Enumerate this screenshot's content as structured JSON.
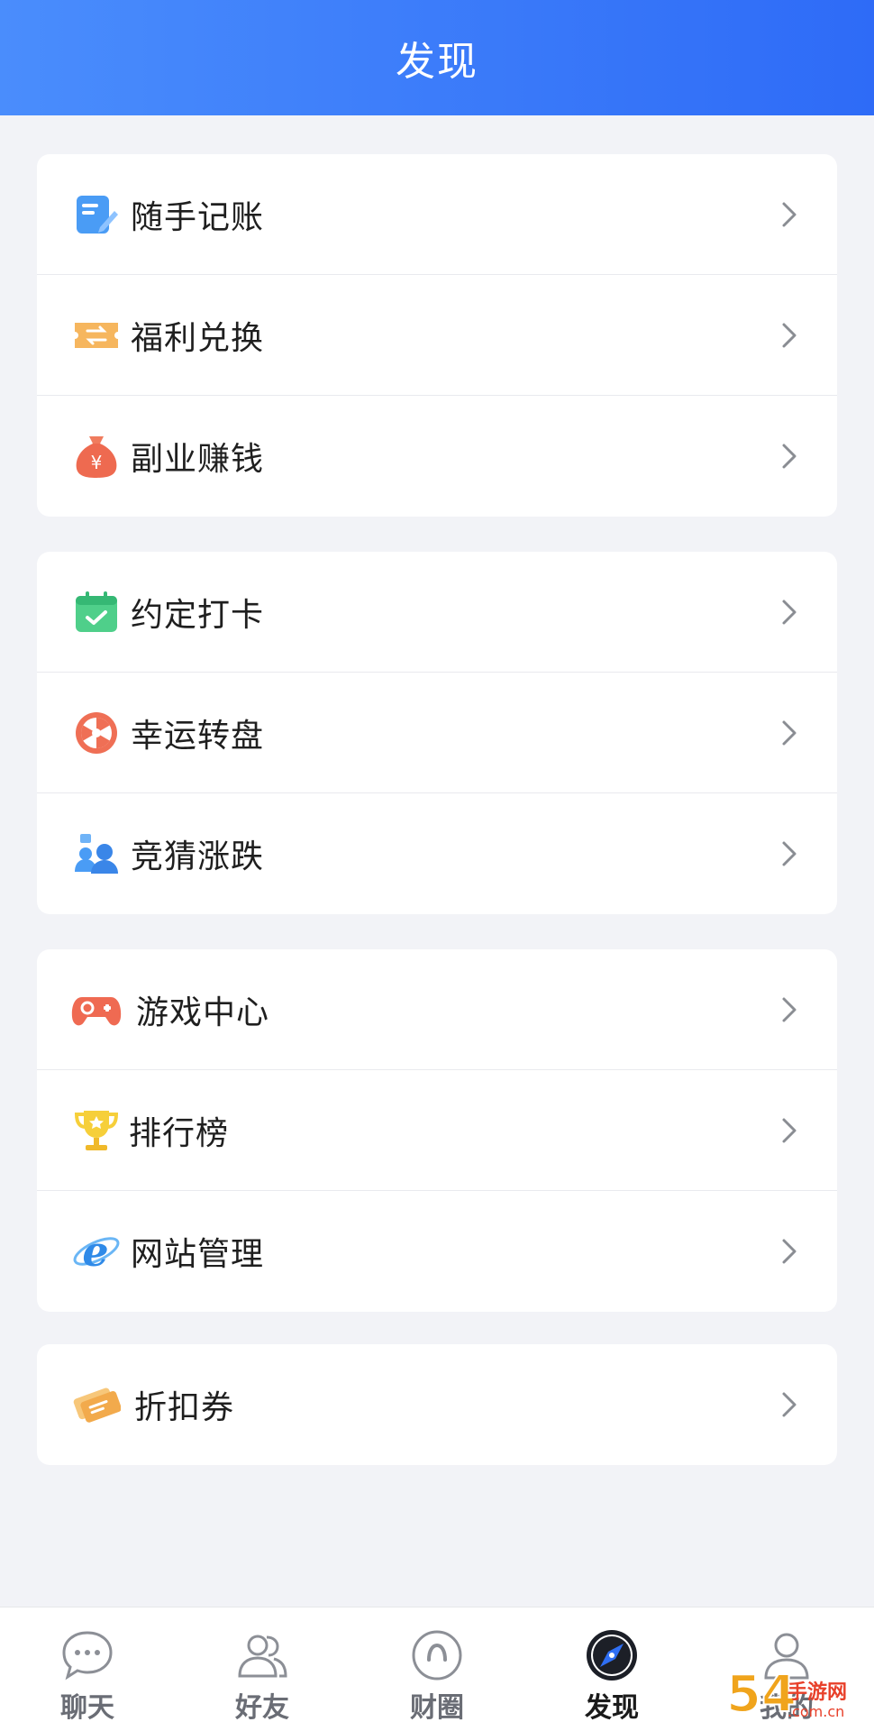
{
  "header": {
    "title": "发现"
  },
  "groups": [
    {
      "items": [
        {
          "label": "随手记账",
          "icon": "notebook-pen-icon"
        },
        {
          "label": "福利兑换",
          "icon": "ticket-exchange-icon"
        },
        {
          "label": "副业赚钱",
          "icon": "money-bag-icon"
        }
      ]
    },
    {
      "items": [
        {
          "label": "约定打卡",
          "icon": "calendar-check-icon"
        },
        {
          "label": "幸运转盘",
          "icon": "lucky-wheel-icon"
        },
        {
          "label": "竞猜涨跌",
          "icon": "people-guess-icon"
        }
      ]
    },
    {
      "items": [
        {
          "label": "游戏中心",
          "icon": "gamepad-icon"
        },
        {
          "label": "排行榜",
          "icon": "trophy-icon"
        },
        {
          "label": "网站管理",
          "icon": "browser-e-icon"
        }
      ]
    },
    {
      "items": [
        {
          "label": "折扣券",
          "icon": "coupon-icon"
        }
      ]
    }
  ],
  "tabbar": {
    "active": "发现",
    "tabs": [
      {
        "label": "聊天",
        "icon": "chat-bubble-icon"
      },
      {
        "label": "好友",
        "icon": "friends-icon"
      },
      {
        "label": "财圈",
        "icon": "circle-icon"
      },
      {
        "label": "发现",
        "icon": "compass-icon"
      },
      {
        "label": "我的",
        "icon": "user-icon"
      }
    ]
  },
  "colors": {
    "header_start": "#4a8dfc",
    "header_end": "#2e6bf7",
    "background": "#f2f3f7",
    "text": "#1f1f1f",
    "tab_inactive": "#6a6d75"
  },
  "watermark": {
    "text": "54手游网",
    "subtext": ".com.cn"
  }
}
